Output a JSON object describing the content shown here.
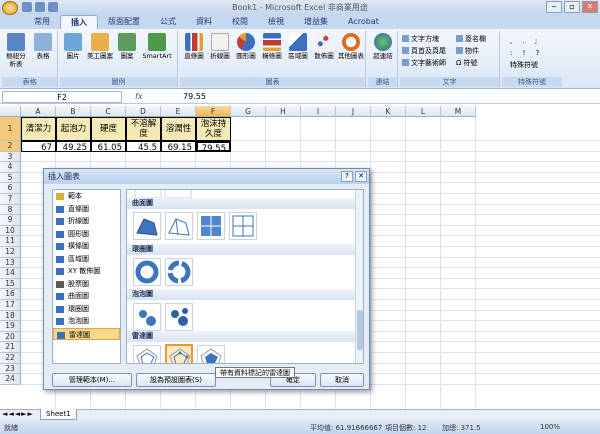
{
  "window": {
    "title": "Book1 - Microsoft Excel 非商業用途"
  },
  "tabs": [
    "常用",
    "插入",
    "版面配置",
    "公式",
    "資料",
    "校閱",
    "檢視",
    "增益集",
    "Acrobat"
  ],
  "ribbon": {
    "groups": [
      {
        "label": "表格",
        "buttons": [
          "樞紐分析表",
          "表格"
        ]
      },
      {
        "label": "圖例",
        "buttons": [
          "圖片",
          "美工圖案",
          "圖案",
          "SmartArt"
        ]
      },
      {
        "label": "圖表",
        "buttons": [
          "直條圖",
          "折線圖",
          "圓形圖",
          "橫條圖",
          "區域圖",
          "散佈圖",
          "其他圖表"
        ]
      },
      {
        "label": "連結",
        "buttons": [
          "超連結"
        ]
      },
      {
        "label": "文字",
        "buttons": [
          "文字方塊",
          "頁首及頁尾",
          "文字藝術師",
          "簽名欄",
          "物件",
          "符號"
        ]
      },
      {
        "label": "特殊符號",
        "buttons": [
          "特殊符號"
        ]
      }
    ]
  },
  "formula_bar": {
    "name_box": "F2",
    "fx": "fx",
    "value": "79.55"
  },
  "columns": [
    "A",
    "B",
    "C",
    "D",
    "E",
    "F",
    "G",
    "H",
    "I",
    "J",
    "K",
    "L",
    "M"
  ],
  "rows": [
    "1",
    "2",
    "3",
    "4",
    "5",
    "6",
    "7",
    "8",
    "9",
    "10",
    "11",
    "12",
    "13",
    "14",
    "15",
    "16",
    "17",
    "18",
    "19",
    "20",
    "21",
    "22",
    "23",
    "24"
  ],
  "table": {
    "headers": [
      "清潔力",
      "起泡力",
      "硬度",
      "不溶解度",
      "溶潤性",
      "泡沫持久度"
    ],
    "values": [
      "67",
      "49.25",
      "61.05",
      "45.5",
      "69.15",
      "79.55"
    ]
  },
  "dialog": {
    "title": "插入圖表",
    "categories": [
      "範本",
      "直條圖",
      "折線圖",
      "圓形圖",
      "橫條圖",
      "區域圖",
      "XY 散佈圖",
      "股票圖",
      "曲面圖",
      "環圈圖",
      "泡泡圖",
      "雷達圖"
    ],
    "selected_category": "雷達圖",
    "sections": [
      "曲面圖",
      "環圈圖",
      "泡泡圖",
      "雷達圖"
    ],
    "buttons": {
      "manage": "管理範本(M)...",
      "set_default": "設為預設圖表(S)",
      "ok": "確定",
      "cancel": "取消"
    },
    "tooltip": "帶有資料標記的雷達圖"
  },
  "sheet_tab": "Sheet1",
  "status": {
    "ready": "就緒",
    "average": "平均值: 61.91666667",
    "count": "項目個數: 12",
    "sum": "加總: 371.5",
    "zoom": "100%"
  }
}
